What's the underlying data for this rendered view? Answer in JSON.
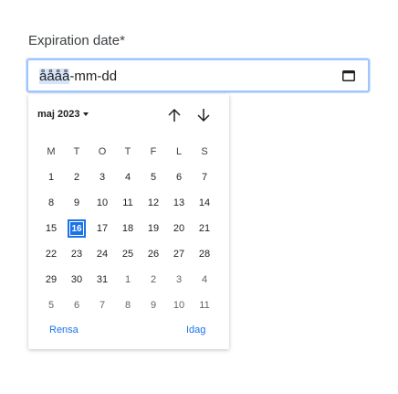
{
  "field": {
    "label": "Expiration date*",
    "value_selected_segment": "åååå",
    "value_rest": "-mm-dd"
  },
  "picker": {
    "month_label": "maj 2023",
    "weekdays": [
      "M",
      "T",
      "O",
      "T",
      "F",
      "L",
      "S"
    ],
    "weeks": [
      [
        {
          "d": "1"
        },
        {
          "d": "2"
        },
        {
          "d": "3"
        },
        {
          "d": "4"
        },
        {
          "d": "5"
        },
        {
          "d": "6"
        },
        {
          "d": "7"
        }
      ],
      [
        {
          "d": "8"
        },
        {
          "d": "9"
        },
        {
          "d": "10"
        },
        {
          "d": "11"
        },
        {
          "d": "12"
        },
        {
          "d": "13"
        },
        {
          "d": "14"
        }
      ],
      [
        {
          "d": "15"
        },
        {
          "d": "16",
          "selected": true
        },
        {
          "d": "17"
        },
        {
          "d": "18"
        },
        {
          "d": "19"
        },
        {
          "d": "20"
        },
        {
          "d": "21"
        }
      ],
      [
        {
          "d": "22"
        },
        {
          "d": "23"
        },
        {
          "d": "24"
        },
        {
          "d": "25"
        },
        {
          "d": "26"
        },
        {
          "d": "27"
        },
        {
          "d": "28"
        }
      ],
      [
        {
          "d": "29"
        },
        {
          "d": "30"
        },
        {
          "d": "31"
        },
        {
          "d": "1",
          "other": true
        },
        {
          "d": "2",
          "other": true
        },
        {
          "d": "3",
          "other": true
        },
        {
          "d": "4",
          "other": true
        }
      ],
      [
        {
          "d": "5",
          "other": true
        },
        {
          "d": "6",
          "other": true
        },
        {
          "d": "7",
          "other": true
        },
        {
          "d": "8",
          "other": true
        },
        {
          "d": "9",
          "other": true
        },
        {
          "d": "10",
          "other": true
        },
        {
          "d": "11",
          "other": true
        }
      ]
    ],
    "clear_label": "Rensa",
    "today_label": "Idag"
  },
  "colors": {
    "accent": "#1a73e8",
    "focus_ring": "#9ec5ff"
  },
  "icons": {
    "calendar": "calendar-icon",
    "prev": "arrow-up-icon",
    "next": "arrow-down-icon",
    "dropdown": "caret-down-icon"
  }
}
